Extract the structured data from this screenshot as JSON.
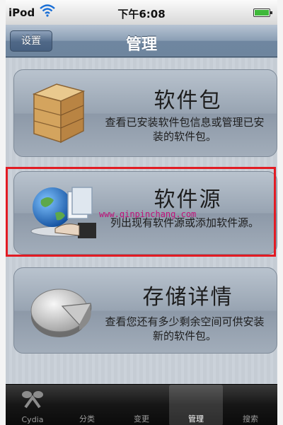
{
  "status_bar": {
    "carrier": "iPod",
    "time": "下午6:08"
  },
  "nav": {
    "left_button": "设置",
    "title": "管理"
  },
  "cards": [
    {
      "icon": "package-box-icon",
      "title": "软件包",
      "description": "查看已安装软件包信息或管理已安装的软件包。"
    },
    {
      "icon": "globe-source-icon",
      "title": "软件源",
      "description": "列出现有软件源或添加软件源。"
    },
    {
      "icon": "storage-pie-icon",
      "title": "存储详情",
      "description": "查看您还有多少剩余空间可供安装新的软件包。"
    }
  ],
  "watermark": "www.qinpinchang.com",
  "tabs": [
    {
      "label": "Cydia",
      "active": false
    },
    {
      "label": "分类",
      "active": false
    },
    {
      "label": "变更",
      "active": false
    },
    {
      "label": "管理",
      "active": true
    },
    {
      "label": "搜索",
      "active": false
    }
  ],
  "colors": {
    "highlight": "#e21b23",
    "battery": "#3fb93a",
    "watermark": "#c0127a"
  }
}
